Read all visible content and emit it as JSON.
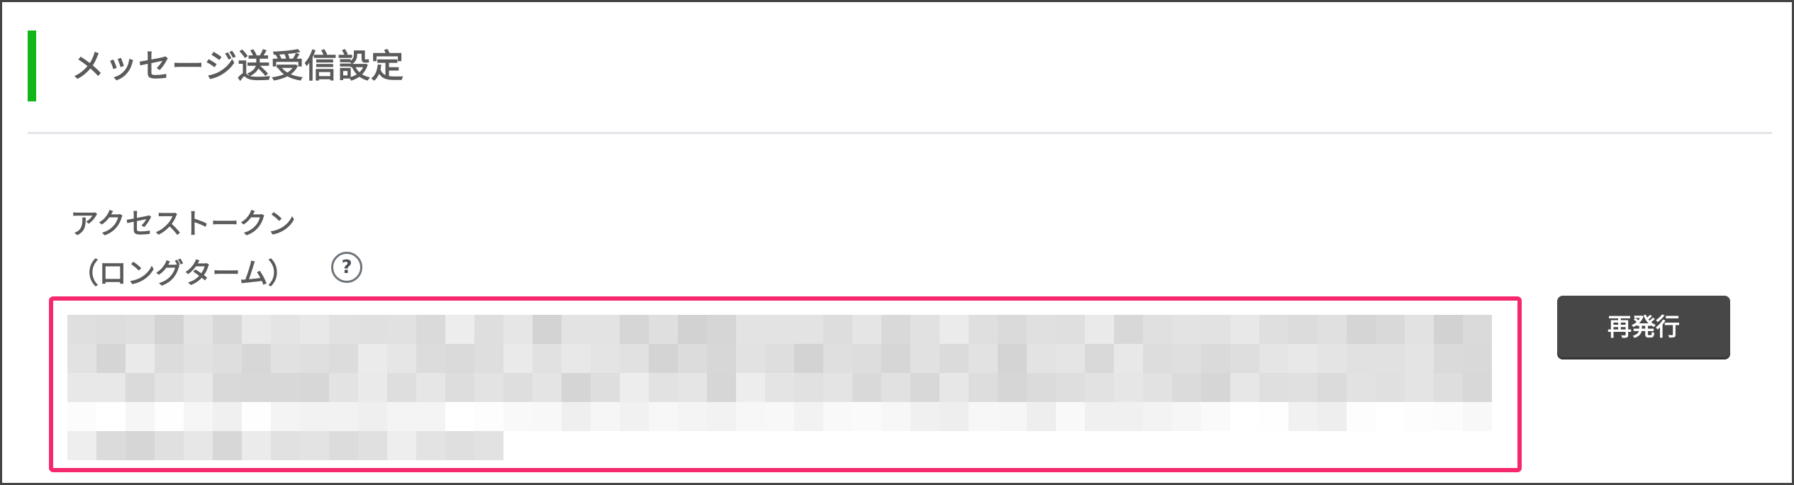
{
  "section": {
    "title": "メッセージ送受信設定",
    "accent_color": "#11b719"
  },
  "access_token": {
    "label_line1": "アクセストークン",
    "label_line2": "（ロングターム）",
    "help_icon": "question-circle-icon",
    "help_glyph": "?",
    "value_state": "redacted (pixelated)",
    "highlight_color": "#f5286e"
  },
  "actions": {
    "reissue_label": "再発行"
  }
}
